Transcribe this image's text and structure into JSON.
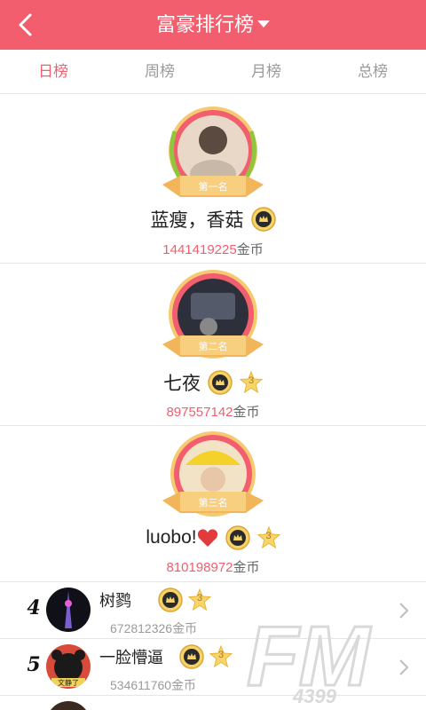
{
  "header": {
    "title": "富豪排行榜",
    "back_icon": "back-arrow-icon",
    "dropdown_icon": "caret-down-icon",
    "color": "#f25e6e"
  },
  "tabs": [
    {
      "label": "日榜",
      "active": true
    },
    {
      "label": "周榜",
      "active": false
    },
    {
      "label": "月榜",
      "active": false
    },
    {
      "label": "总榜",
      "active": false
    }
  ],
  "podium": [
    {
      "rank_label": "第一名",
      "name": "蓝瘦，香菇",
      "coins": "1441419225",
      "unit": "金币",
      "level": ""
    },
    {
      "rank_label": "第二名",
      "name": "七夜",
      "coins": "897557142",
      "unit": "金币",
      "level": "3"
    },
    {
      "rank_label": "第三名",
      "name": "luobo!",
      "coins": "810198972",
      "unit": "金币",
      "level": "3"
    }
  ],
  "list": [
    {
      "rank": "4",
      "name": "树鹨",
      "coins": "672812326金币",
      "level": "3"
    },
    {
      "rank": "5",
      "name": "一脸懵逼",
      "coins": "534611760金币",
      "level": "3",
      "avatar_caption": "文静了"
    }
  ],
  "watermark": {
    "text": "FM",
    "sub": "4399"
  },
  "accent_color": "#f25e6e"
}
